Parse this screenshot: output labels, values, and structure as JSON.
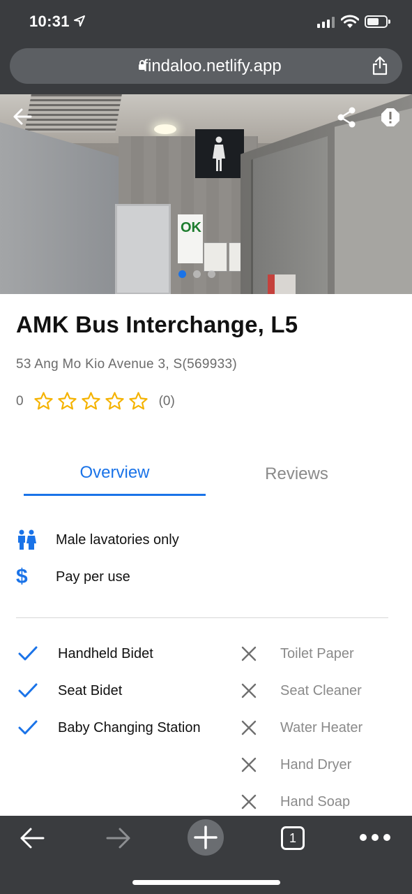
{
  "status_bar": {
    "time": "10:31"
  },
  "browser": {
    "url": "findaloo.netlify.app",
    "open_tabs": "1"
  },
  "place": {
    "title": "AMK Bus Interchange, L5",
    "address": "53 Ang Mo Kio Avenue 3, S(569933)",
    "rating": "0",
    "review_count": "(0)",
    "stars_filled": 0,
    "stars_total": 5
  },
  "tabs": {
    "overview": "Overview",
    "reviews": "Reviews"
  },
  "info": {
    "gender": "Male lavatories only",
    "payment": "Pay per use"
  },
  "amenities_available": [
    "Handheld Bidet",
    "Seat Bidet",
    "Baby Changing Station"
  ],
  "amenities_unavailable": [
    "Toilet Paper",
    "Seat Cleaner",
    "Water Heater",
    "Hand Dryer",
    "Hand Soap"
  ],
  "carousel": {
    "slide_count": 3,
    "active_index": 0
  },
  "colors": {
    "accent": "#1a73e8",
    "star": "#f5b301",
    "chrome": "#3a3c3f",
    "muted": "#8a8a8a"
  },
  "hero_image": {
    "poster_text": "OK"
  }
}
